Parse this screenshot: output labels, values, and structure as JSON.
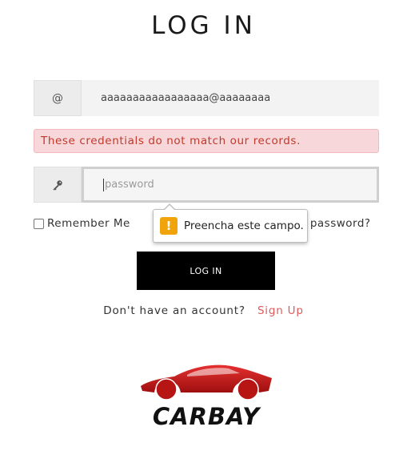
{
  "page": {
    "title": "LOG IN"
  },
  "form": {
    "email": {
      "icon": "at-icon",
      "icon_glyph": "@",
      "value": "aaaaaaaaaaaaaaaaa@aaaaaaaa"
    },
    "error": "These credentials do not match our records.",
    "password": {
      "icon": "key-icon",
      "placeholder": "password",
      "value": ""
    },
    "remember_label": "Remember Me",
    "forgot_label": "r password?",
    "submit_label": "LOG IN"
  },
  "validation_tooltip": {
    "icon": "warning-icon",
    "icon_glyph": "!",
    "message": "Preencha este campo."
  },
  "signup": {
    "prompt": "Don't have an account?",
    "link_label": "Sign Up"
  },
  "logo": {
    "text": "CARBAY"
  },
  "colors": {
    "error_bg": "#f8d7da",
    "error_text": "#c0392b",
    "button_bg": "#000000",
    "link": "#e05a5a",
    "warning": "#f0a30a",
    "logo_red": "#d31f1f"
  }
}
